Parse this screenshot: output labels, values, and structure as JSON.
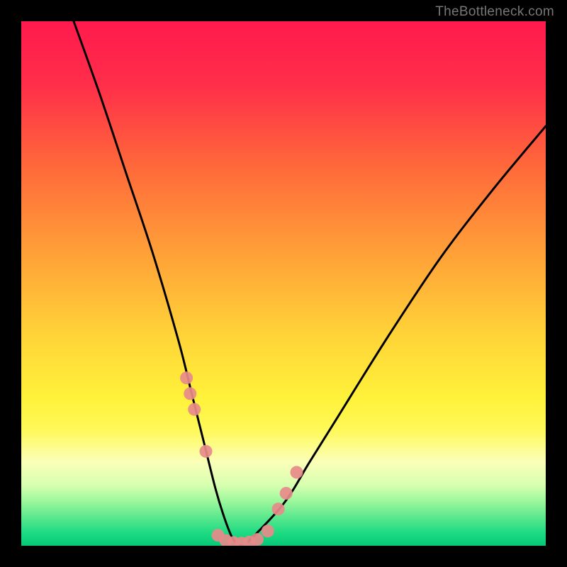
{
  "watermark": "TheBottleneck.com",
  "chart_data": {
    "type": "line",
    "title": "",
    "xlabel": "",
    "ylabel": "",
    "xlim": [
      0,
      100
    ],
    "ylim": [
      0,
      100
    ],
    "series": [
      {
        "name": "bottleneck-curve",
        "x": [
          10,
          15,
          20,
          25,
          30,
          32.5,
          35,
          37,
          38.5,
          40,
          41,
          42,
          43,
          50,
          55,
          60,
          70,
          80,
          90,
          100
        ],
        "y": [
          100,
          86,
          71,
          56,
          39,
          29,
          19,
          11,
          6,
          2,
          0.5,
          0,
          0.5,
          8,
          16,
          24,
          40,
          55,
          68,
          80
        ],
        "color": "#000000"
      },
      {
        "name": "markers-left",
        "type": "scatter",
        "x": [
          31.5,
          32.2,
          33.0,
          35.2
        ],
        "y": [
          32,
          29,
          26,
          18
        ],
        "color": "#e88a8a"
      },
      {
        "name": "markers-bottom",
        "type": "scatter",
        "x": [
          37.5,
          39,
          40.5,
          42,
          43.5,
          45,
          47
        ],
        "y": [
          2.0,
          1.0,
          0.6,
          0.5,
          0.7,
          1.2,
          2.8
        ],
        "color": "#e88a8a"
      },
      {
        "name": "markers-right",
        "type": "scatter",
        "x": [
          49,
          50.5,
          52.5
        ],
        "y": [
          7,
          10,
          14
        ],
        "color": "#e88a8a"
      }
    ],
    "background_gradient": {
      "stops": [
        {
          "offset": 0.0,
          "color": "#ff1a4d"
        },
        {
          "offset": 0.12,
          "color": "#ff2e4a"
        },
        {
          "offset": 0.28,
          "color": "#ff6a3a"
        },
        {
          "offset": 0.45,
          "color": "#ffa338"
        },
        {
          "offset": 0.6,
          "color": "#ffd438"
        },
        {
          "offset": 0.72,
          "color": "#fff23a"
        },
        {
          "offset": 0.78,
          "color": "#fff95a"
        },
        {
          "offset": 0.84,
          "color": "#fbffb8"
        },
        {
          "offset": 0.885,
          "color": "#d6ffb0"
        },
        {
          "offset": 0.915,
          "color": "#9cf79c"
        },
        {
          "offset": 0.945,
          "color": "#5de88e"
        },
        {
          "offset": 0.975,
          "color": "#1edb83"
        },
        {
          "offset": 1.0,
          "color": "#06c877"
        }
      ]
    }
  }
}
